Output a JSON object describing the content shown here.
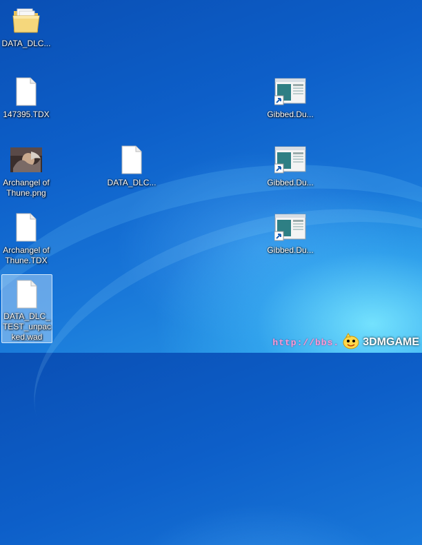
{
  "desktop": {
    "icons": [
      {
        "label": "DATA_DLC..."
      },
      {
        "label": "147395.TDX"
      },
      {
        "label": "Archangel of Thune.png"
      },
      {
        "label": "Archangel of Thune.TDX"
      },
      {
        "label": "DATA_DLC_TEST_unpacked.wad"
      },
      {
        "label": "DATA_DLC..."
      },
      {
        "label": "Gibbed.Du..."
      },
      {
        "label": "Gibbed.Du..."
      },
      {
        "label": "Gibbed.Du..."
      }
    ]
  },
  "watermark": {
    "url": "http://bbs.",
    "brand": "3DMGAME"
  }
}
